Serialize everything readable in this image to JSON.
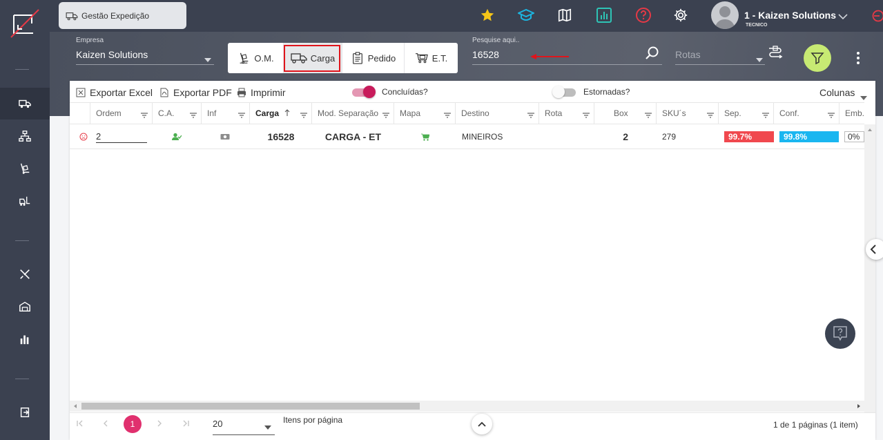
{
  "module": {
    "label": "Gestão Expedição",
    "icon": "truck-icon"
  },
  "header": {
    "user_name": "1 - Kaizen Solutions",
    "user_role": "TECNICO",
    "icons": [
      "star-icon",
      "graduation-cap-icon",
      "map-icon",
      "analytics-icon",
      "help-circle-icon",
      "gear-icon"
    ],
    "colors": {
      "star": "#f5c518",
      "graduation": "#1cb5e0",
      "analytics": "#2ec4b6",
      "help": "#e63946"
    }
  },
  "sidebar": {
    "items": [
      {
        "icon": "truck-icon",
        "active": true
      },
      {
        "icon": "network-icon",
        "active": false
      },
      {
        "icon": "hand-truck-icon",
        "active": false
      },
      {
        "icon": "forklift-icon",
        "active": false
      },
      {
        "icon": "tools-icon",
        "active": false
      },
      {
        "icon": "warehouse-icon",
        "active": false
      },
      {
        "icon": "bar-chart-icon",
        "active": false
      },
      {
        "icon": "exit-icon",
        "active": false
      }
    ]
  },
  "filters": {
    "empresa_label": "Empresa",
    "empresa_value": "Kaizen Solutions",
    "search_label": "Pesquise aqui..",
    "search_value": "16528",
    "rotas_placeholder": "Rotas"
  },
  "segments": [
    {
      "label": "O.M.",
      "icon": "hand-truck-icon",
      "selected": false
    },
    {
      "label": "Carga",
      "icon": "truck-icon",
      "selected": true
    },
    {
      "label": "Pedido",
      "icon": "clipboard-icon",
      "selected": false
    },
    {
      "label": "E.T.",
      "icon": "cart-icon",
      "selected": false
    }
  ],
  "toolbar": {
    "export_excel": "Exportar Excel",
    "export_pdf": "Exportar PDF",
    "print": "Imprimir",
    "concluidas": "Concluídas?",
    "concluidas_on": true,
    "estornadas": "Estornadas?",
    "estornadas_on": false,
    "colunas": "Colunas"
  },
  "table": {
    "columns": [
      "Ordem",
      "C.A.",
      "Inf",
      "Carga",
      "Mod. Separação",
      "Mapa",
      "Destino",
      "Rota",
      "Box",
      "SKU´s",
      "Sep.",
      "Conf.",
      "Emb."
    ],
    "rows": [
      {
        "ordem": "2",
        "ca": "user-check-icon",
        "inf": "money-icon",
        "carga": "16528",
        "mod_separacao": "CARGA - ET",
        "mapa": "cart-icon",
        "destino": "MINEIROS",
        "rota": "",
        "box": "2",
        "skus": "279",
        "sep": "99.7%",
        "sep_fraction": 0.997,
        "conf": "99.8%",
        "conf_fraction": 0.998,
        "emb": "0%",
        "emb_fraction": 0
      }
    ],
    "colors": {
      "sep": "#f0484e",
      "conf": "#1ab6f0",
      "accent": "#e0306e",
      "toggle": "#c81b5b"
    }
  },
  "pager": {
    "current_page": "1",
    "page_size": "20",
    "items_per_page_label": "Itens por página",
    "summary": "1 de 1 páginas (1 item)"
  }
}
